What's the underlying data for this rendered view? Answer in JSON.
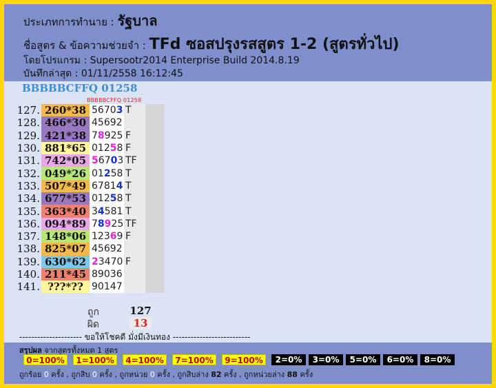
{
  "header": {
    "type_label": "ประเภทการทำนาย :",
    "type_value": "รัฐบาล",
    "formula_label": "ชื่อสูตร & ข้อความช่วยจำ :",
    "formula_value": "TFd ซอสปรุงรสสูตร 1-2 (สูตรทั่วไป)",
    "program": "โดยโปรแกรม : Supersootr2014 Enterprise Build 2014.8.19",
    "saved": "บันทึกล่าสุด : 01/11/2558 16:12:45"
  },
  "code_title": "BBBBBCFFQ 01258",
  "small_code": "BBBBBCFFQ 01258",
  "rows": [
    {
      "num": "127.",
      "pair": "260*38",
      "digits": [
        "5",
        "6",
        "7",
        "0",
        "3"
      ],
      "marks": [
        "",
        "",
        "",
        "",
        "b"
      ],
      "result": "T",
      "color": "#f5b84a"
    },
    {
      "num": "128.",
      "pair": "466*30",
      "digits": [
        "4",
        "5",
        "6",
        "9",
        "2"
      ],
      "marks": [
        "",
        "",
        "",
        "",
        ""
      ],
      "result": "",
      "color": "#9a78c0"
    },
    {
      "num": "129.",
      "pair": "421*38",
      "digits": [
        "7",
        "8",
        "9",
        "2",
        "5"
      ],
      "marks": [
        "",
        "m",
        "",
        "",
        ""
      ],
      "result": "F",
      "color": "#9a78c0"
    },
    {
      "num": "130.",
      "pair": "881*65",
      "digits": [
        "0",
        "1",
        "2",
        "5",
        "8"
      ],
      "marks": [
        "",
        "",
        "",
        "m",
        ""
      ],
      "result": "F",
      "color": "#fff59d"
    },
    {
      "num": "131.",
      "pair": "742*05",
      "digits": [
        "5",
        "6",
        "7",
        "0",
        "3"
      ],
      "marks": [
        "m",
        "",
        "",
        "b",
        ""
      ],
      "result": "TF",
      "color": "#e6a8e6"
    },
    {
      "num": "132.",
      "pair": "049*26",
      "digits": [
        "0",
        "1",
        "2",
        "5",
        "8"
      ],
      "marks": [
        "",
        "",
        "b",
        "",
        ""
      ],
      "result": "T",
      "color": "#b6e878"
    },
    {
      "num": "133.",
      "pair": "507*49",
      "digits": [
        "6",
        "7",
        "8",
        "1",
        "4"
      ],
      "marks": [
        "",
        "",
        "",
        "",
        "b"
      ],
      "result": "T",
      "color": "#f5b84a"
    },
    {
      "num": "134.",
      "pair": "677*53",
      "digits": [
        "0",
        "1",
        "2",
        "5",
        "8"
      ],
      "marks": [
        "",
        "",
        "",
        "b",
        ""
      ],
      "result": "T",
      "color": "#9a78c0"
    },
    {
      "num": "135.",
      "pair": "363*40",
      "digits": [
        "3",
        "4",
        "5",
        "8",
        "1"
      ],
      "marks": [
        "",
        "b",
        "",
        "",
        ""
      ],
      "result": "T",
      "color": "#f08070"
    },
    {
      "num": "136.",
      "pair": "094*89",
      "digits": [
        "7",
        "8",
        "9",
        "2",
        "5"
      ],
      "marks": [
        "",
        "b",
        "m",
        "",
        ""
      ],
      "result": "TF",
      "color": "#e6a8e6"
    },
    {
      "num": "137.",
      "pair": "148*06",
      "digits": [
        "1",
        "2",
        "3",
        "6",
        "9"
      ],
      "marks": [
        "",
        "",
        "",
        "m",
        ""
      ],
      "result": "F",
      "color": "#b6e878"
    },
    {
      "num": "138.",
      "pair": "825*07",
      "digits": [
        "4",
        "5",
        "6",
        "9",
        "2"
      ],
      "marks": [
        "",
        "",
        "",
        "",
        ""
      ],
      "result": "",
      "color": "#f5b84a"
    },
    {
      "num": "139.",
      "pair": "630*62",
      "digits": [
        "2",
        "3",
        "4",
        "7",
        "0"
      ],
      "marks": [
        "m",
        "",
        "",
        "",
        ""
      ],
      "result": "F",
      "color": "#7ec8f0"
    },
    {
      "num": "140.",
      "pair": "211*45",
      "digits": [
        "8",
        "9",
        "0",
        "3",
        "6"
      ],
      "marks": [
        "",
        "",
        "",
        "",
        ""
      ],
      "result": "",
      "color": "#f08070"
    },
    {
      "num": "141.",
      "pair": "???*??",
      "digits": [
        "9",
        "0",
        "1",
        "4",
        "7"
      ],
      "marks": [
        "",
        "",
        "",
        "",
        ""
      ],
      "result": "",
      "color": "#fff59d"
    }
  ],
  "tally": {
    "right_label": "ถูก",
    "right_value": "127",
    "wrong_label": "ผิด",
    "wrong_value": "13"
  },
  "divider": "--------------------- ขอให้โชคดี มั่งมีเงินทอง --------------------------",
  "summary": {
    "title": "สรุปผล",
    "subtitle": " จากสูตรทั้งหมด 1 สูตร",
    "badges": [
      {
        "label": "0=100%",
        "style": "y"
      },
      {
        "label": "1=100%",
        "style": "y"
      },
      {
        "label": "4=100%",
        "style": "y"
      },
      {
        "label": "7=100%",
        "style": "y"
      },
      {
        "label": "9=100%",
        "style": "y"
      },
      {
        "label": "2=0%",
        "style": "k"
      },
      {
        "label": "3=0%",
        "style": "k"
      },
      {
        "label": "5=0%",
        "style": "k"
      },
      {
        "label": "6=0%",
        "style": "k"
      },
      {
        "label": "8=0%",
        "style": "k"
      }
    ],
    "stats": [
      {
        "t": "ถูกร้อย ",
        "w": false
      },
      {
        "t": "0",
        "w": true
      },
      {
        "t": " ครั้ง , ถูกสิบ ",
        "w": false
      },
      {
        "t": "0",
        "w": true
      },
      {
        "t": " ครั้ง , ถูกหน่วย ",
        "w": false
      },
      {
        "t": "0",
        "w": true
      },
      {
        "t": " ครั้ง , ถูกสิบล่าง ",
        "w": false
      },
      {
        "t": "82",
        "w": false,
        "b": true
      },
      {
        "t": " ครั้ง , ถูกหน่วยล่าง ",
        "w": false
      },
      {
        "t": "88",
        "w": false,
        "b": true
      },
      {
        "t": " ครั้ง",
        "w": false
      }
    ]
  }
}
